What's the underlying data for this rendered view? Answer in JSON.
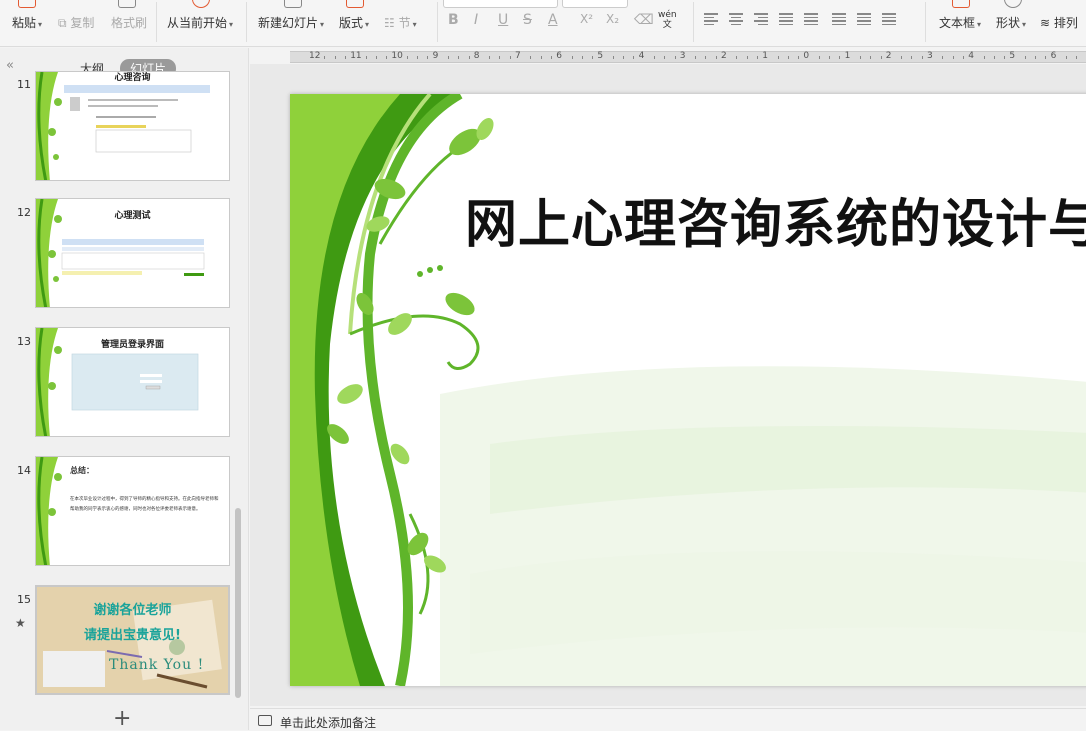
{
  "ribbon": {
    "paste": "粘贴",
    "copy": "复制",
    "format_painter": "格式刷",
    "from_current": "从当前开始",
    "new_slide": "新建幻灯片",
    "layout": "版式",
    "section": "节",
    "text_box": "文本框",
    "shape": "形状",
    "arrange": "排列",
    "format_glyphs": [
      "B",
      "I",
      "U",
      "S",
      "A",
      "X²",
      "X₂"
    ],
    "wen_icon": "wén\n文"
  },
  "panel": {
    "collapse": "«",
    "tab_outline": "大纲",
    "tab_slides": "幻灯片",
    "add": "+",
    "slides": [
      {
        "num": "11",
        "title": "心理咨询"
      },
      {
        "num": "12",
        "title": "心理测试"
      },
      {
        "num": "13",
        "title": "管理员登录界面"
      },
      {
        "num": "14",
        "title": "总结："
      },
      {
        "num": "15",
        "title": "",
        "star": "★",
        "line1": "谢谢各位老师",
        "line2": "请提出宝贵意见!",
        "thanks": "Thank You !"
      }
    ],
    "thumb14_text": "在本次毕业设计过程中，得到了导师的精心指导和支持。在此向指导老师和帮助我的同学表示衷心的感谢，同时也对各位评委老师表示谢意。"
  },
  "ruler": {
    "labels": [
      "12",
      "11",
      "10",
      "9",
      "8",
      "7",
      "6",
      "5",
      "4",
      "3",
      "2",
      "1",
      "0",
      "1",
      "2",
      "3",
      "4",
      "5",
      "6"
    ]
  },
  "slide": {
    "title": "网上心理咨询系统的设计与"
  },
  "notes": {
    "placeholder": "单击此处添加备注"
  },
  "colors": {
    "green_dark": "#3f9a12",
    "green_light": "#8fd13a",
    "accent_orange": "#e35a32"
  }
}
